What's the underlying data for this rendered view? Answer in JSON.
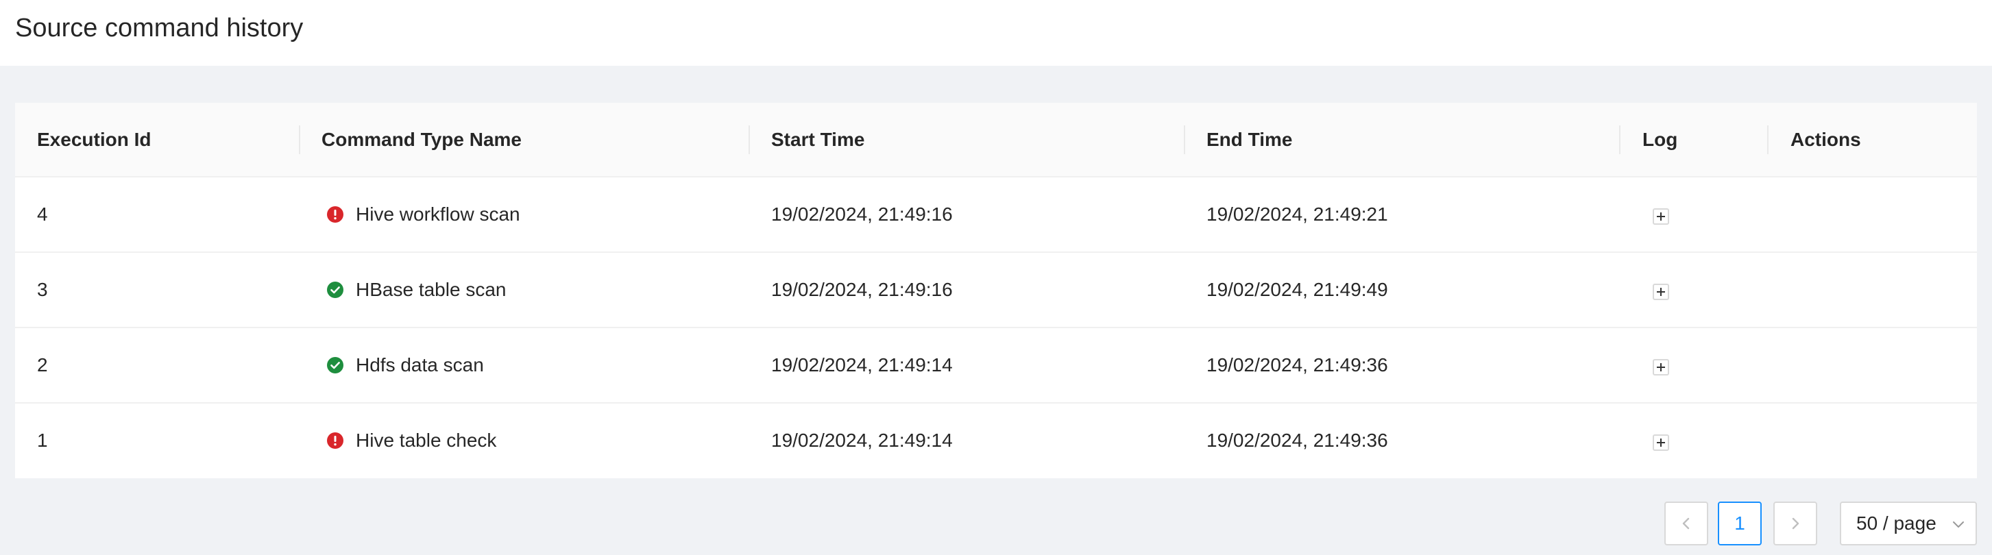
{
  "page": {
    "title": "Source command history"
  },
  "table": {
    "columns": [
      "Execution Id",
      "Command Type Name",
      "Start Time",
      "End Time",
      "Log",
      "Actions"
    ],
    "rows": [
      {
        "execution_id": "4",
        "status": "error",
        "status_icon": "error-circle-icon",
        "command_type_name": "Hive workflow scan",
        "start_time": "19/02/2024, 21:49:16",
        "end_time": "19/02/2024, 21:49:21",
        "log_icon": "plus-icon"
      },
      {
        "execution_id": "3",
        "status": "success",
        "status_icon": "check-circle-icon",
        "command_type_name": "HBase table scan",
        "start_time": "19/02/2024, 21:49:16",
        "end_time": "19/02/2024, 21:49:49",
        "log_icon": "plus-icon"
      },
      {
        "execution_id": "2",
        "status": "success",
        "status_icon": "check-circle-icon",
        "command_type_name": "Hdfs data scan",
        "start_time": "19/02/2024, 21:49:14",
        "end_time": "19/02/2024, 21:49:36",
        "log_icon": "plus-icon"
      },
      {
        "execution_id": "1",
        "status": "error",
        "status_icon": "error-circle-icon",
        "command_type_name": "Hive table check",
        "start_time": "19/02/2024, 21:49:14",
        "end_time": "19/02/2024, 21:49:36",
        "log_icon": "plus-icon"
      }
    ]
  },
  "pagination": {
    "current_page": "1",
    "page_size": "50 / page",
    "prev_icon": "chevron-left-icon",
    "next_icon": "chevron-right-icon",
    "page_size_icon": "chevron-down-icon"
  },
  "colors": {
    "background": "#f0f2f5",
    "header_bg": "#fafafa",
    "error": "#d9262b",
    "success": "#1e8e3e",
    "primary": "#1890ff",
    "border": "#d9d9d9"
  }
}
